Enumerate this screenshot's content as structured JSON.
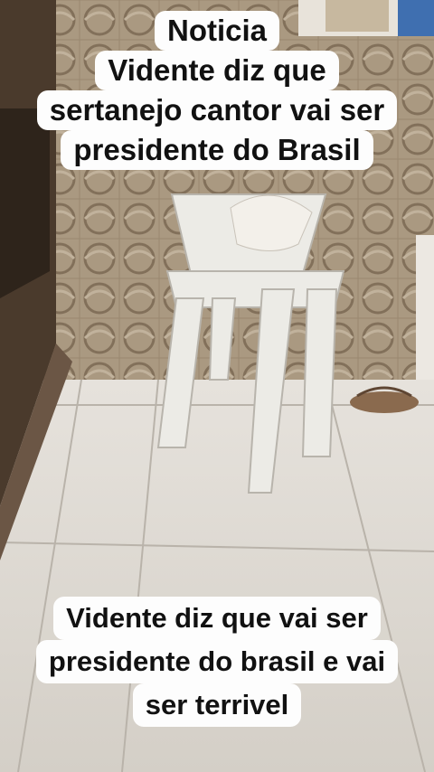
{
  "top_caption": {
    "lines": [
      "Noticia",
      "Vidente diz que",
      "sertanejo cantor vai ser",
      "presidente do Brasil"
    ]
  },
  "bottom_caption": {
    "lines": [
      "Vidente diz que vai ser",
      "presidente do brasil e vai",
      "ser terrivel"
    ]
  }
}
